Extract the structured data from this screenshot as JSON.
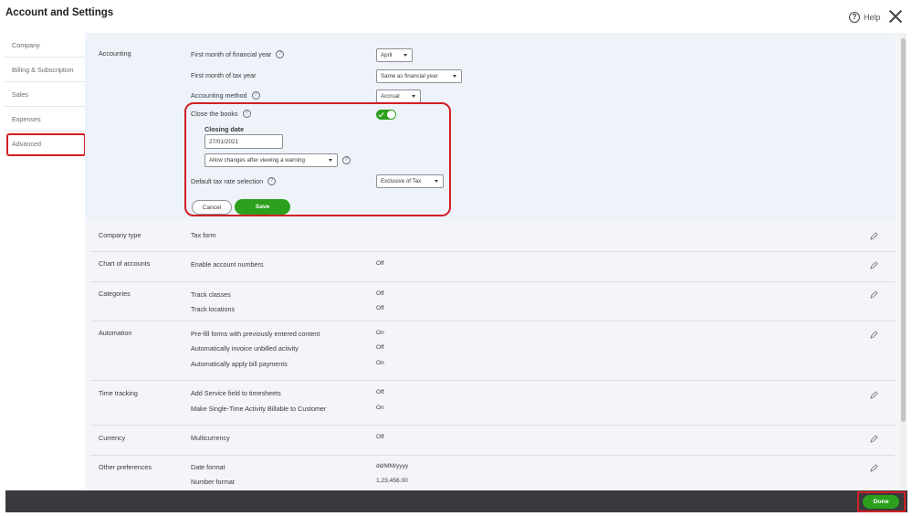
{
  "window": {
    "title": "Account and Settings",
    "help_label": "Help"
  },
  "sidebar": {
    "items": [
      {
        "label": "Company"
      },
      {
        "label": "Billing & Subscription"
      },
      {
        "label": "Sales"
      },
      {
        "label": "Expenses"
      },
      {
        "label": "Advanced"
      }
    ]
  },
  "accounting": {
    "section": "Accounting",
    "first_month_fy": {
      "label": "First month of financial year",
      "value": "April"
    },
    "first_month_tax": {
      "label": "First month of tax year",
      "value": "Same as financial year"
    },
    "accounting_method": {
      "label": "Accounting method",
      "value": "Accrual"
    },
    "close_books": {
      "label": "Close the books",
      "enabled": true
    },
    "closing_date": {
      "label": "Closing date",
      "value": "27/01/2021"
    },
    "allow_changes": {
      "value": "Allow changes after viewing a warning"
    },
    "default_tax": {
      "label": "Default tax rate selection",
      "value": "Exclusive of Tax"
    },
    "cancel_label": "Cancel",
    "save_label": "Save"
  },
  "sections": {
    "company_type": {
      "label": "Company type",
      "rows": [
        {
          "label": "Tax form",
          "value": ""
        }
      ]
    },
    "chart_of_accounts": {
      "label": "Chart of accounts",
      "rows": [
        {
          "label": "Enable account numbers",
          "value": "Off"
        }
      ]
    },
    "categories": {
      "label": "Categories",
      "rows": [
        {
          "label": "Track classes",
          "value": "Off"
        },
        {
          "label": "Track locations",
          "value": "Off"
        }
      ]
    },
    "automation": {
      "label": "Automation",
      "rows": [
        {
          "label": "Pre-fill forms with previously entered content",
          "value": "On"
        },
        {
          "label": "Automatically invoice unbilled activity",
          "value": "Off"
        },
        {
          "label": "Automatically apply bill payments",
          "value": "On"
        }
      ]
    },
    "time_tracking": {
      "label": "Time tracking",
      "rows": [
        {
          "label": "Add Service field to timesheets",
          "value": "Off"
        },
        {
          "label": "Make Single-Time Activity Billable to Customer",
          "value": "On"
        }
      ]
    },
    "currency": {
      "label": "Currency",
      "rows": [
        {
          "label": "Multicurrency",
          "value": "Off"
        }
      ]
    },
    "other_preferences": {
      "label": "Other preferences",
      "rows": [
        {
          "label": "Date format",
          "value": "dd/MM/yyyy"
        },
        {
          "label": "Number format",
          "value": "1,23,456.00"
        }
      ]
    }
  },
  "footer": {
    "done_label": "Done"
  },
  "colors": {
    "accent": "#2ca01c",
    "annotation": "#d01f26",
    "footer": "#393a3d"
  }
}
